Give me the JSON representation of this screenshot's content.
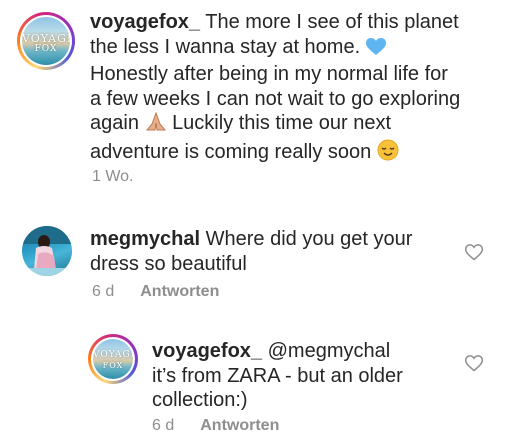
{
  "comments": [
    {
      "username": "voyagefox_",
      "text_line1": "The more I see of this planet",
      "text_line2": "the less I wanna stay at home.",
      "text_line3": "Honestly after being in my normal life for",
      "text_line4": "a few weeks I can not wait to go exploring",
      "text_line5a": "again",
      "text_line5b": "Luckily this time our next",
      "text_line6": "adventure is coming really soon",
      "time": "1 Wo.",
      "avatar_text_top": "VOYAGE",
      "avatar_text_bottom": "FOX"
    },
    {
      "username": "megmychal",
      "text_line1": "Where did you get your",
      "text_line2": "dress so beautiful",
      "time": "6 d",
      "reply_label": "Antworten"
    },
    {
      "username": "voyagefox_",
      "mention": "@megmychal",
      "text_line1": "it’s from ZARA - but an older",
      "text_line2": "collection:)",
      "time": "6 d",
      "reply_label": "Antworten",
      "avatar_text_top": "VOYAGE",
      "avatar_text_bottom": "FOX"
    }
  ],
  "icons": {
    "heart": "heart-outline-icon",
    "blue_heart": "blue-heart-emoji",
    "praying_hands": "praying-hands-emoji",
    "smile": "relieved-face-emoji"
  },
  "colors": {
    "text": "#262626",
    "meta": "#8e8e8e",
    "blue_heart": "#5fb5f0",
    "emoji_yellow": "#f7c23a"
  }
}
